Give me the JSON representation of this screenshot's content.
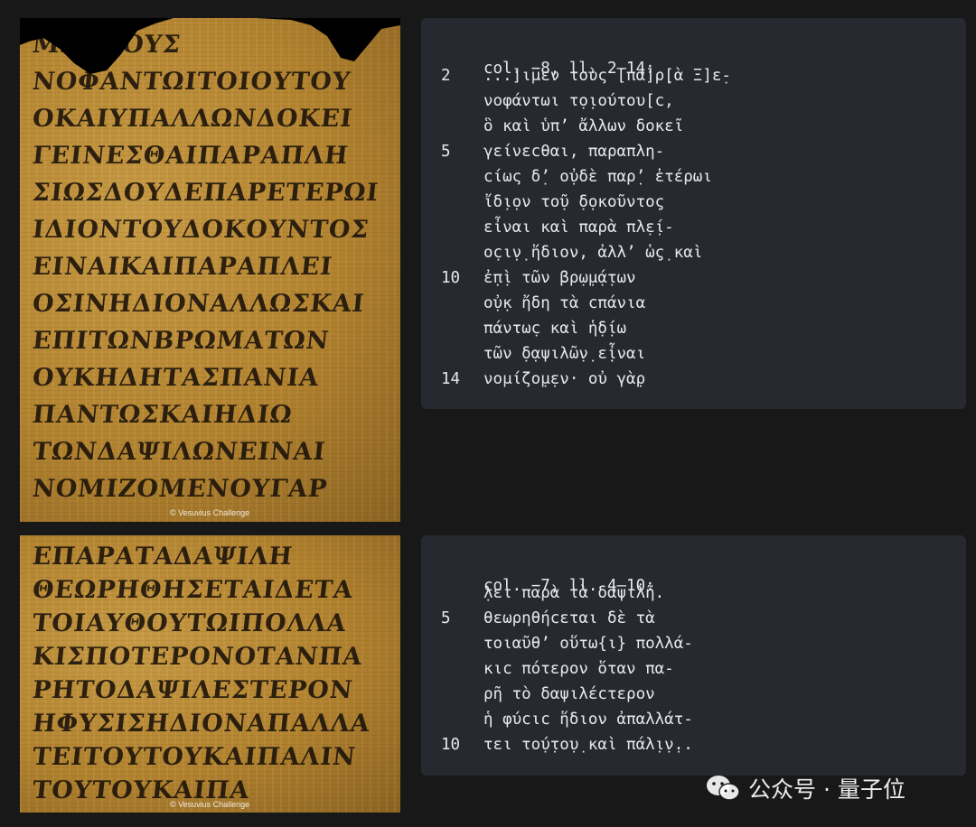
{
  "top": {
    "image_credit": "© Vesuvius Challenge",
    "heading": "col. −8, ll. 2–14:",
    "lines": [
      {
        "num": "2",
        "text": "...]ιμεν τοὺς [πα]ρ̣[ὰ Ξ]ε̣-"
      },
      {
        "num": "",
        "text": "νοφάντωι τ̣ο̣ιούτου[c,"
      },
      {
        "num": "",
        "text": "ὃ καὶ ὑπ’ ἄλλων δοκεῖ"
      },
      {
        "num": "5",
        "text": "γείνεcθαι, παραπλη-"
      },
      {
        "num": "",
        "text": "cίως δ̣’ ο̣ὐδὲ παρ̣’ ἑτέρωι"
      },
      {
        "num": "",
        "text": "ἴδ̣ι̣ον το̣ῦ ̣δ̣οκοῦντο̣ς"
      },
      {
        "num": "",
        "text": "εἶναι καὶ παρὰ πλ̣ε̣ί-"
      },
      {
        "num": "",
        "text": "οc̣ι̣ν̣ ἥδιον, ἀλλ’ ὡ̣ς̣ καὶ"
      },
      {
        "num": "10",
        "text": "ἐ̣π̣ὶ τῶν βρ̣ω̣μ̣ά̣των"
      },
      {
        "num": "",
        "text": "ο̣ὐ̣κ ἤδη τὰ cπάνια"
      },
      {
        "num": "",
        "text": "πάντωc̣ καὶ ἡ̣δ̣ίω"
      },
      {
        "num": "",
        "text": "τῶν ̣δ̣αψιλῶ̣ν̣ ε̣̣ἶναι"
      },
      {
        "num": "14",
        "text": "νομίζο̣μ̣εν· οὐ γὰ̣ρ"
      }
    ],
    "ink_lines": [
      "ΜΕΝΤΟΥΣ",
      "ΝΟΦΑΝΤΩΙΤΟΙΟΥΤΟΥ",
      "ΟΚΑΙΥΠΑΛΛΩΝΔΟΚΕΙ",
      "ΓΕΙΝΕΣΘΑΙΠΑΡΑΠΛΗ",
      "ΣΙΩΣΔΟΥΔΕΠΑΡΕΤΕΡΩΙ",
      "ΙΔΙΟΝΤΟΥΔΟΚΟΥΝΤΟΣ",
      "ΕΙΝΑΙΚΑΙΠΑΡΑΠΛΕΙ",
      "ΟΣΙΝΗΔΙΟΝΑΛΛΩΣΚΑΙ",
      "ΕΠΙΤΩΝΒΡΩΜΑΤΩΝ",
      "ΟΥΚΗΔΗΤΑΣΠΑΝΙΑ",
      "ΠΑΝΤΩΣΚΑΙΗΔΙΩ",
      "ΤΩΝΔΑΨΙΛΩΝΕΙΝΑΙ",
      "ΝΟΜΙΖΟΜΕΝΟΥΓΑΡ"
    ]
  },
  "bottom": {
    "image_credit": "© Vesuvius Challenge",
    "heading": "col. −7, ll. 4–10:",
    "lines": [
      {
        "num": "",
        "text": "̣λει παρὰ τὰ δαψιλῆ."
      },
      {
        "num": "5",
        "text": "θεωρηθήcεται δὲ τὰ"
      },
      {
        "num": "",
        "text": "τοιαῦθ’ οὕτω{ι} πολλά-"
      },
      {
        "num": "",
        "text": "κιc πότερον ὅταν πα-"
      },
      {
        "num": "",
        "text": "ρῆ τὸ δαψιλέcτερον"
      },
      {
        "num": "",
        "text": "ἡ φύcιc ἥδιον ἀπαλλάτ-"
      },
      {
        "num": "10",
        "text": "τει το̣ύ̣το̣υ̣ καὶ πάλ̣ι̣ν̣.."
      }
    ],
    "ink_lines": [
      "ΕΠΑΡΑΤΑΔΑΨΙΛΗ",
      "ΘΕΩΡΗΘΗΣΕΤΑΙΔΕΤΑ",
      "ΤΟΙΑΥΘΟΥΤΩΙΠΟΛΛΑ",
      "ΚΙΣΠΟΤΕΡΟΝΟΤΑΝΠΑ",
      "ΡΗΤΟΔΑΨΙΛΕΣΤΕΡΟΝ",
      "ΗΦΥΣΙΣΗΔΙΟΝΑΠΑΛΛΑ",
      "ΤΕΙΤΟΥΤΟΥΚΑΙΠΑΛΙΝ",
      "ΤΟΥΤΟΥΚΑΙΠΑ"
    ]
  },
  "watermark": {
    "text": "公众号 · 量子位",
    "icon": "wechat-icon"
  }
}
